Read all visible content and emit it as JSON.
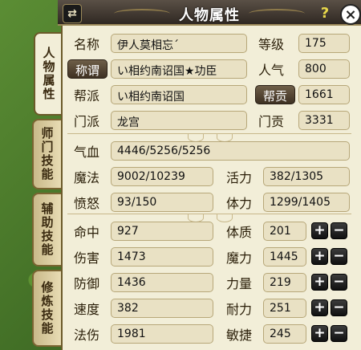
{
  "window": {
    "title": "人物属性",
    "help_symbol": "?",
    "close_symbol": "×",
    "swap_symbol": "⇄"
  },
  "tabs": [
    {
      "label": "人物属性",
      "active": true
    },
    {
      "label": "师门技能",
      "active": false
    },
    {
      "label": "辅助技能",
      "active": false
    },
    {
      "label": "修炼技能",
      "active": false
    }
  ],
  "info": {
    "name_label": "名称",
    "name_value": "伊人莫相忘ˊ",
    "level_label": "等级",
    "level_value": "175",
    "title_button": "称谓",
    "title_value": "い相约南诏国★功臣",
    "popularity_label": "人气",
    "popularity_value": "800",
    "guild_label": "帮派",
    "guild_value": "い相约南诏国",
    "contribution_button": "帮贡",
    "contribution_value": "1661",
    "school_label": "门派",
    "school_value": "龙宫",
    "school_contribution_label": "门贡",
    "school_contribution_value": "3331"
  },
  "vitals": {
    "hp_label": "气血",
    "hp_value": "4446/5256/5256",
    "mp_label": "魔法",
    "mp_value": "9002/10239",
    "vigor_label": "活力",
    "vigor_value": "382/1305",
    "anger_label": "愤怒",
    "anger_value": "93/150",
    "stamina_label": "体力",
    "stamina_value": "1299/1405"
  },
  "combat": {
    "hit_label": "命中",
    "hit_value": "927",
    "damage_label": "伤害",
    "damage_value": "1473",
    "defense_label": "防御",
    "defense_value": "1436",
    "speed_label": "速度",
    "speed_value": "382",
    "spell_label": "法伤",
    "spell_value": "1981"
  },
  "attributes": {
    "con_label": "体质",
    "con_value": "201",
    "mag_label": "魔力",
    "mag_value": "1445",
    "str_label": "力量",
    "str_value": "219",
    "end_label": "耐力",
    "end_value": "251",
    "agi_label": "敏捷",
    "agi_value": "245",
    "plus": "+",
    "minus": "−"
  },
  "colors": {
    "panel_bg": "#f2eed8",
    "field_bg": "#e9e1c4",
    "title_bar": "#2f2822",
    "help_icon": "#e8d84a",
    "close_icon": "#ffffff"
  }
}
